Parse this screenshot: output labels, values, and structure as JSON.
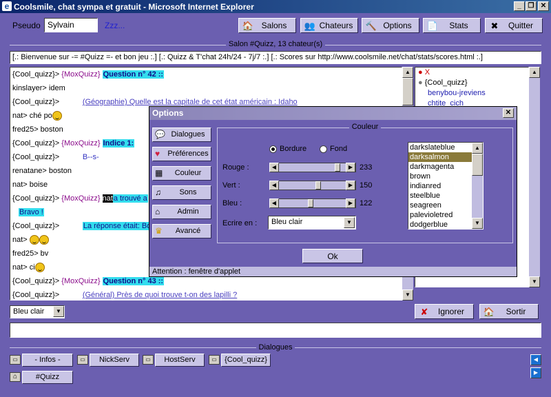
{
  "window": {
    "title": "Coolsmile, chat sympa et gratuit - Microsoft Internet Explorer",
    "min": "_",
    "max": "❐",
    "close": "✕"
  },
  "toolbar": {
    "pseudo_label": "Pseudo",
    "pseudo_value": "Sylvain",
    "zzz": "Zzz...",
    "salons": "Salons",
    "chateurs": "Chateurs",
    "options": "Options",
    "stats": "Stats",
    "quitter": "Quitter"
  },
  "salon_header": "Salon #Quizz, 13 chateur(s)",
  "topic": "[.: Bienvenue sur -= #Quizz =- et bon jeu :.] [.: Quizz & T'chat 24h/24 - 7j/7 :.] [.: Scores sur http://www.coolsmile.net/chat/stats/scores.html :.]",
  "chat": {
    "l1_nick": "{Cool_quizz}>",
    "l1_mox": "{MoxQuizz}",
    "l1_q": "Question n° 42 ::",
    "l2": "kinslayer> idem",
    "l3_nick": "{Cool_quizz}>",
    "l3_link": "(Géographie) Quelle est la capitale de cet état américain : Idaho",
    "l4": "nat> ché po",
    "l5": "fred25> boston",
    "l6_nick": "{Cool_quizz}>",
    "l6_mox": "{MoxQuizz}",
    "l6_q": "Indice 1:",
    "l7_nick": "{Cool_quizz}>",
    "l7_hint": "B--s-",
    "l8": "renatane> boston",
    "l9": "nat> boise",
    "l10_nick": "{Cool_quizz}>",
    "l10_mox": "{MoxQuizz}",
    "l10_nat": "nat",
    "l10_rest": "a trouvé a",
    "l11": "Bravo !",
    "l12_nick": "{Cool_quizz}>",
    "l12_text": "La réponse était: Bo",
    "l13": "nat>",
    "l14": "fred25> bv",
    "l15": "nat> ci",
    "l16_nick": "{Cool_quizz}>",
    "l16_mox": "{MoxQuizz}",
    "l16_q": "Question n° 43 ::",
    "l17_nick": "{Cool_quizz}>",
    "l17_link": "(Général) Près de quoi trouve t-on des lapilli ?"
  },
  "users": [
    "X",
    "{Cool_quizz}",
    "benybou-jreviens",
    "chtite_cich"
  ],
  "below_chat": {
    "color_select": "Bleu clair",
    "ignorer": "Ignorer",
    "sortir": "Sortir"
  },
  "dialogues": {
    "header": "Dialogues",
    "tabs": [
      "- Infos -",
      "NickServ",
      "HostServ",
      "{Cool_quizz}"
    ],
    "room_tab": "#Quizz"
  },
  "options_dialog": {
    "title": "Options",
    "close": "✕",
    "tabs": [
      "Dialogues",
      "Préférences",
      "Couleur",
      "Sons",
      "Admin",
      "Avancé"
    ],
    "group_title": "Couleur",
    "radio_bordure": "Bordure",
    "radio_fond": "Fond",
    "rouge_label": "Rouge :",
    "rouge_value": "233",
    "vert_label": "Vert :",
    "vert_value": "150",
    "bleu_label": "Bleu :",
    "bleu_value": "122",
    "ecrire_label": "Ecrire en :",
    "ecrire_value": "Bleu clair",
    "colors": [
      "darkslateblue",
      "darksalmon",
      "darkmagenta",
      "brown",
      "indianred",
      "steelblue",
      "seagreen",
      "palevioletred",
      "dodgerblue"
    ],
    "ok": "Ok",
    "status": "Attention : fenêtre d'applet"
  },
  "colors": {
    "bg": "#6b5fb0",
    "accent": "#33ddee",
    "title": "#0a246a"
  }
}
